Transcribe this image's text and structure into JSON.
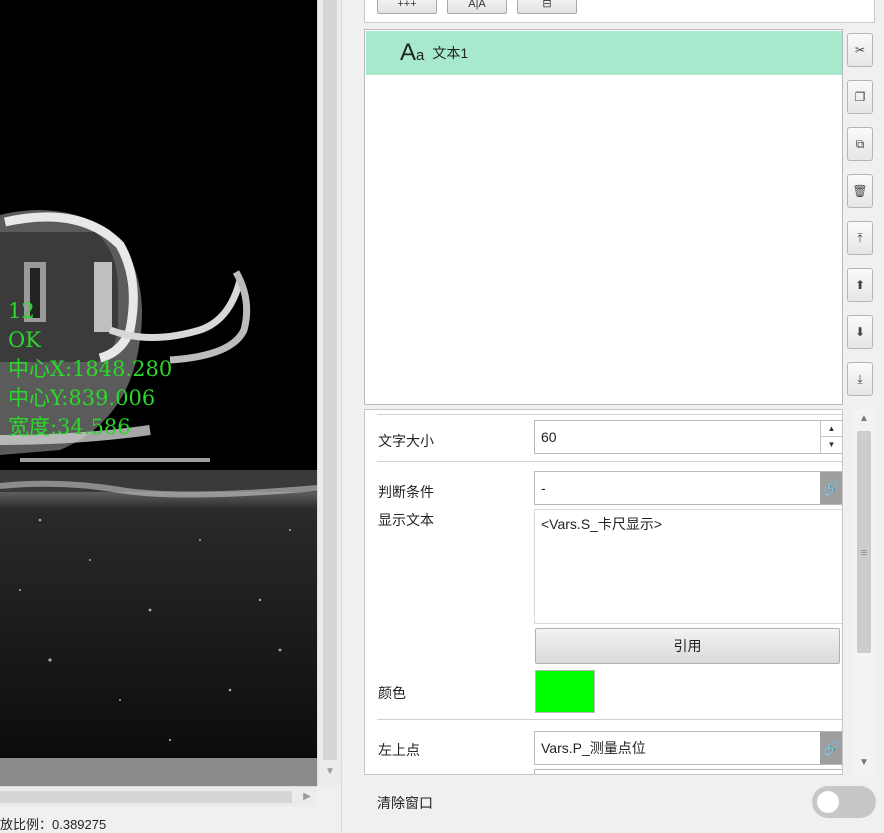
{
  "viewer": {
    "overlay_lines": [
      "12",
      "OK",
      "中心X:1848.280",
      "中心Y:839.006",
      "宽度:34.586"
    ],
    "overlay_color": "#2bd82b",
    "zoom_status": "放比例：0.389275"
  },
  "toolbar": {
    "buttons": [
      "+++",
      "A|A",
      "⊟"
    ]
  },
  "element_list": {
    "items": [
      {
        "icon": "text-aa-icon",
        "icon_big": "A",
        "icon_small": "a",
        "label": "文本1",
        "selected": true
      }
    ],
    "selected_color": "#a6e9cc"
  },
  "side_tools": [
    "pin-icon",
    "copy-icon",
    "paste-icon",
    "delete-icon",
    "move-top-icon",
    "move-up-icon",
    "move-down-icon",
    "move-bottom-icon"
  ],
  "properties": {
    "font_size": {
      "label": "文字大小",
      "value": "60"
    },
    "condition": {
      "label": "判断条件",
      "value": "-"
    },
    "display_text": {
      "label": "显示文本",
      "value": "<Vars.S_卡尺显示>"
    },
    "reference_button": "引用",
    "color": {
      "label": "颜色",
      "value": "#00ff00"
    },
    "top_left": {
      "label": "左上点",
      "value": "Vars.P_测量点位"
    }
  },
  "clear_window": {
    "label": "清除窗口",
    "enabled": false
  }
}
